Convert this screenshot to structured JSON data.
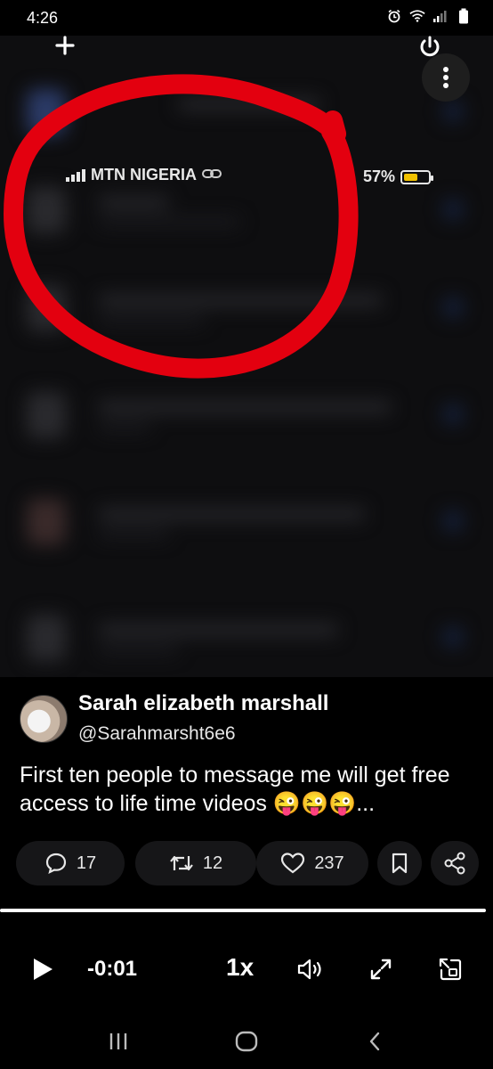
{
  "status_bar": {
    "time": "4:26",
    "icons": [
      "alarm-icon",
      "wifi-icon",
      "signal-icon",
      "battery-icon"
    ]
  },
  "top_controls": {
    "add_icon": "plus-icon",
    "power_icon": "power-icon",
    "more_icon": "more-vertical-icon"
  },
  "video_screen": {
    "carrier": "MTN NIGERIA",
    "battery_percent": "57%",
    "battery_level": 0.57,
    "annotation_color": "#e3000f"
  },
  "tweet": {
    "author_name": "Sarah elizabeth marshall",
    "handle": "@Sarahmarsht6e6",
    "text": "First ten people to message me will get free access to life time videos 😜😜😜...",
    "replies": "17",
    "reposts": "12",
    "likes": "237"
  },
  "player": {
    "time_remaining": "-0:01",
    "speed": "1x",
    "progress": 1.0
  },
  "colors": {
    "background": "#000000",
    "pill_background": "#161618",
    "battery_fill": "#f2c200"
  }
}
